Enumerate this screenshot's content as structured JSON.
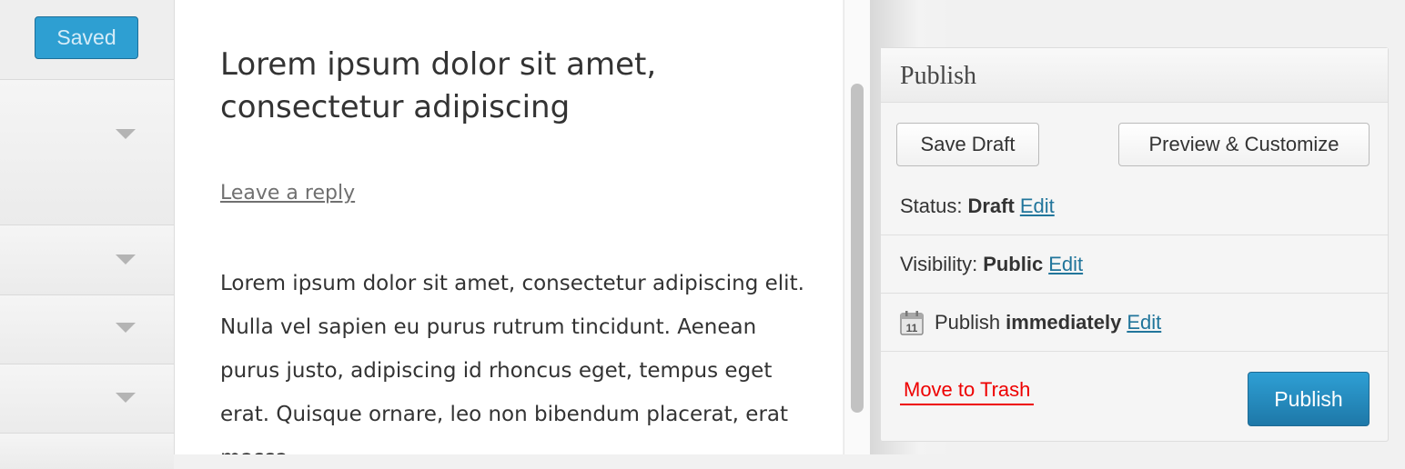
{
  "sidebar": {
    "saved_label": "Saved",
    "sections": [
      "",
      "",
      "",
      ""
    ]
  },
  "preview": {
    "post_title": "Lorem ipsum dolor sit amet, consectetur adipiscing",
    "leave_reply": "Leave a reply",
    "body": "Lorem ipsum dolor sit amet, consectetur adipiscing elit. Nulla vel sapien eu purus rutrum tincidunt. Aenean purus justo, adipiscing id rhoncus eget, tempus eget erat. Quisque ornare, leo non bibendum placerat, erat massa"
  },
  "publish": {
    "title": "Publish",
    "save_draft": "Save Draft",
    "preview_customize": "Preview & Customize",
    "status_label": "Status:",
    "status_value": "Draft",
    "visibility_label": "Visibility:",
    "visibility_value": "Public",
    "schedule_label": "Publish",
    "schedule_value": "immediately",
    "edit_label": "Edit",
    "calendar_day": "11",
    "move_to_trash": "Move to Trash",
    "publish_button": "Publish"
  },
  "colors": {
    "accent": "#2e9fd2",
    "link": "#21759b",
    "danger": "#ee0000"
  },
  "icons": [
    "chevron-down-icon",
    "calendar-icon"
  ]
}
